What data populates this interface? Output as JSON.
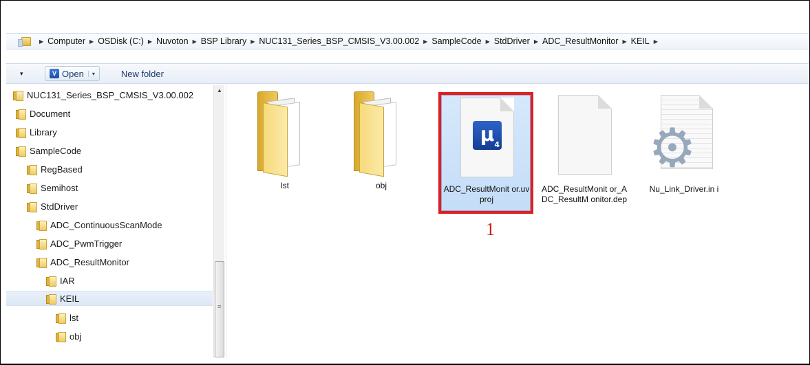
{
  "breadcrumb": [
    "Computer",
    "OSDisk (C:)",
    "Nuvoton",
    "BSP Library",
    "NUC131_Series_BSP_CMSIS_V3.00.002",
    "SampleCode",
    "StdDriver",
    "ADC_ResultMonitor",
    "KEIL"
  ],
  "breadcrumb_separator": "▶",
  "toolbar": {
    "open_label": "Open",
    "open_icon_glyph": "V",
    "new_folder_label": "New folder",
    "dropdown_glyph": "▾"
  },
  "nav_tree": [
    {
      "label": "NUC131_Series_BSP_CMSIS_V3.00.002",
      "icon": "folder-icon"
    },
    {
      "label": "Document",
      "icon": "folder-icon"
    },
    {
      "label": "Library",
      "icon": "folder-icon"
    },
    {
      "label": "SampleCode",
      "icon": "folder-icon"
    },
    {
      "label": "RegBased",
      "icon": "folder-icon"
    },
    {
      "label": "Semihost",
      "icon": "folder-icon"
    },
    {
      "label": "StdDriver",
      "icon": "folder-icon"
    },
    {
      "label": "ADC_ContinuousScanMode",
      "icon": "folder-icon"
    },
    {
      "label": "ADC_PwmTrigger",
      "icon": "folder-icon"
    },
    {
      "label": "ADC_ResultMonitor",
      "icon": "folder-icon"
    },
    {
      "label": "IAR",
      "icon": "folder-icon"
    },
    {
      "label": "KEIL",
      "icon": "folder-icon",
      "selected": true
    },
    {
      "label": "lst",
      "icon": "folder-icon"
    },
    {
      "label": "obj",
      "icon": "folder-icon"
    }
  ],
  "files": [
    {
      "name": "lst",
      "type": "folder"
    },
    {
      "name": "obj",
      "type": "folder"
    },
    {
      "name": "ADC_ResultMonitor.uvproj",
      "display": "ADC_ResultMonit or.uvproj",
      "type": "uvproj",
      "selected": true,
      "logo": "μ",
      "logo_sub": "4"
    },
    {
      "name": "ADC_ResultMonitor_ADC_ResultMonitor.dep",
      "display": "ADC_ResultMonit or_ADC_ResultM onitor.dep",
      "type": "document"
    },
    {
      "name": "Nu_Link_Driver.ini",
      "display": "Nu_Link_Driver.in i",
      "type": "settings",
      "icon": "gear-icon"
    }
  ],
  "annotation": {
    "label": "1",
    "color": "#e21d1d"
  },
  "colors": {
    "selection_border": "#e21d1d",
    "selection_fill": "#cfe3fa",
    "toolbar_text": "#1e3b6c"
  }
}
